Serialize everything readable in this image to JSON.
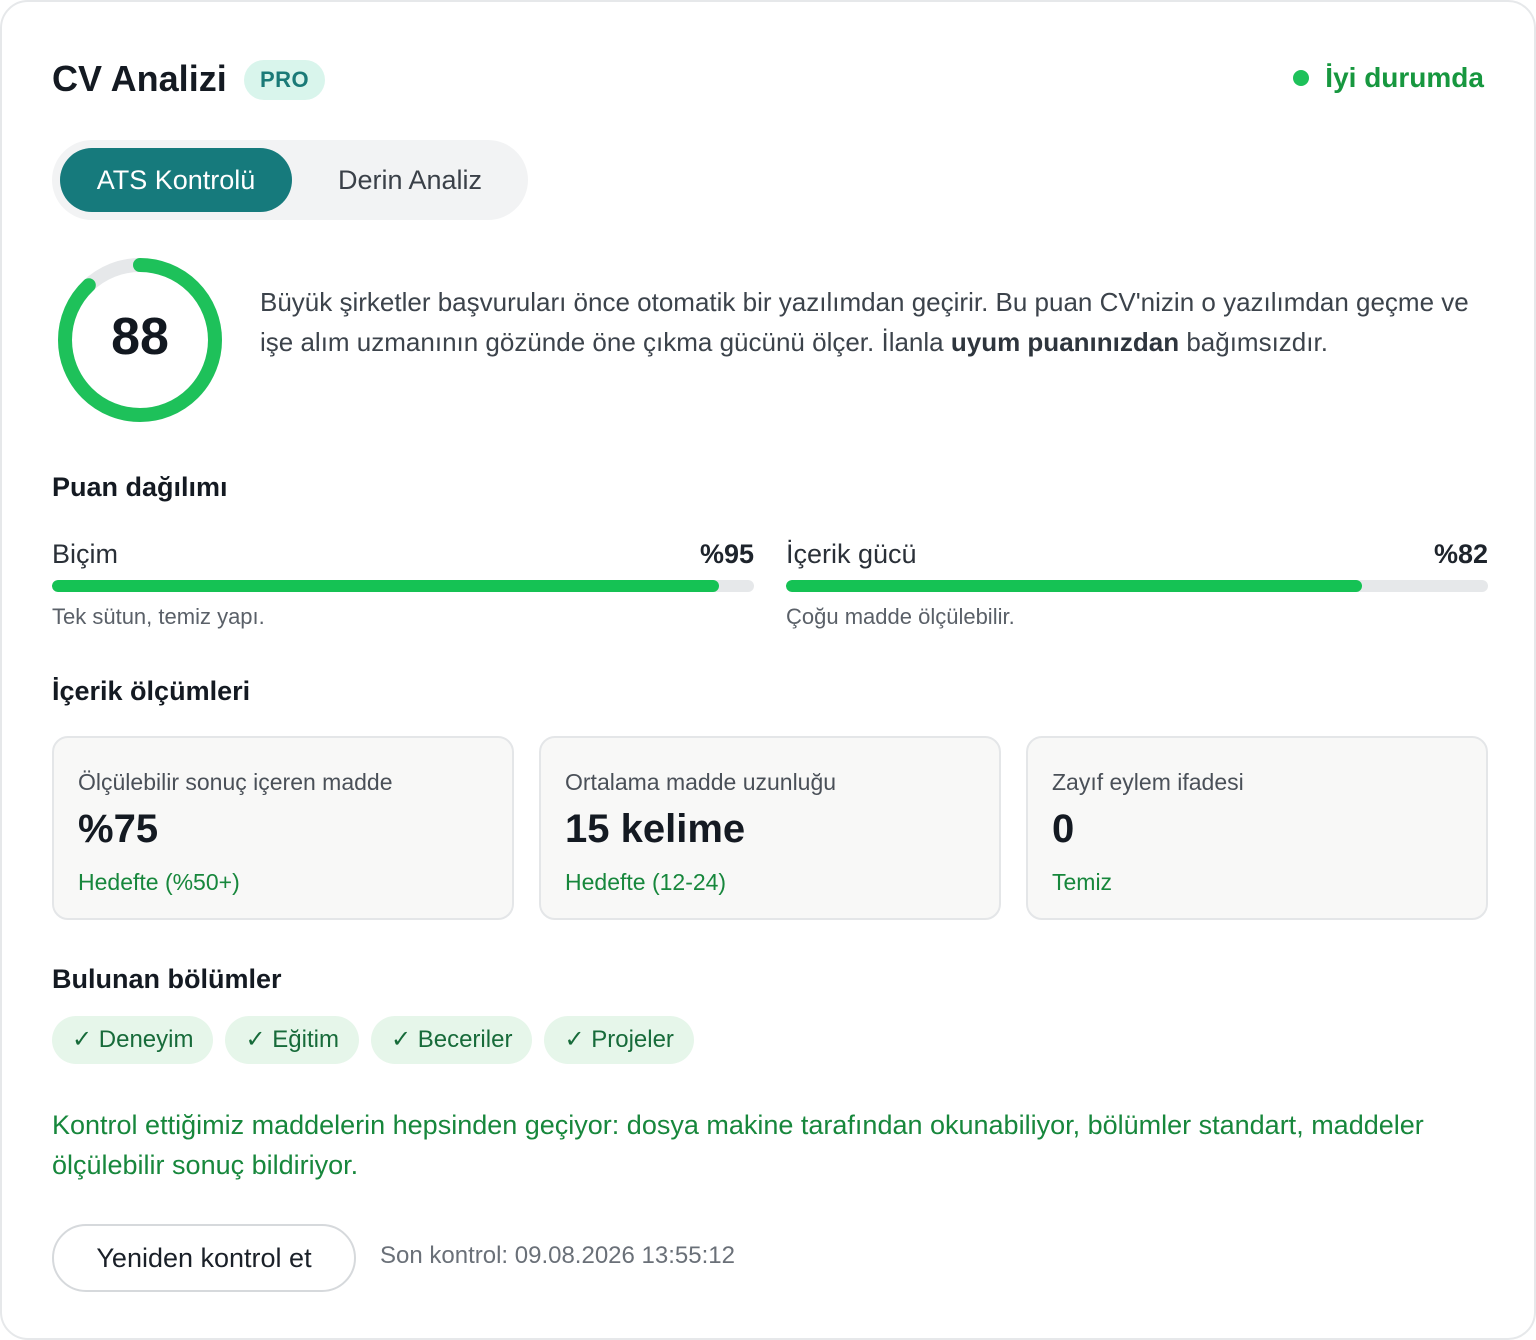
{
  "header": {
    "title": "CV Analizi",
    "badge": "PRO",
    "status_text": "İyi durumda",
    "status_color": "#1ec15a"
  },
  "tabs": [
    {
      "label": "ATS Kontrolü",
      "active": true
    },
    {
      "label": "Derin Analiz",
      "active": false
    }
  ],
  "score": {
    "value": "88",
    "fraction": 0.88
  },
  "intro": {
    "text": "Büyük şirketler başvuruları önce otomatik bir yazılımdan geçirir. Bu puan CV'nizin o yazılımdan geçme ve işe alım uzmanının gözünde öne çıkma gücünü ölçer. İlanla ",
    "emphasis": "uyum puanınızdan",
    "tail": " bağımsızdır."
  },
  "distribution": {
    "title": "Puan dağılımı",
    "items": [
      {
        "label": "Biçim",
        "value": "%95",
        "fraction": 0.95,
        "note": "Tek sütun, temiz yapı."
      },
      {
        "label": "İçerik gücü",
        "value": "%82",
        "fraction": 0.82,
        "note": "Çoğu madde ölçülebilir."
      }
    ]
  },
  "measurements": {
    "title": "İçerik ölçümleri",
    "cards": [
      {
        "label": "Ölçülebilir sonuç içeren madde",
        "value": "%75",
        "status": "Hedefte (%50+)"
      },
      {
        "label": "Ortalama madde uzunluğu",
        "value": "15 kelime",
        "status": "Hedefte (12-24)"
      },
      {
        "label": "Zayıf eylem ifadesi",
        "value": "0",
        "status": "Temiz"
      }
    ]
  },
  "sections": {
    "title": "Bulunan bölümler",
    "items": [
      "✓ Deneyim",
      "✓ Eğitim",
      "✓ Beceriler",
      "✓ Projeler"
    ]
  },
  "summary": "Kontrol ettiğimiz maddelerin hepsinden geçiyor: dosya makine tarafından okunabiliyor, bölümler standart, maddeler ölçülebilir sonuç bildiriyor.",
  "footer": {
    "recheck_label": "Yeniden kontrol et",
    "last_check": "Son kontrol: 09.08.2026 13:55:12"
  },
  "colors": {
    "accent": "#167a7c",
    "success": "#15c254",
    "success_text": "#17873c"
  }
}
